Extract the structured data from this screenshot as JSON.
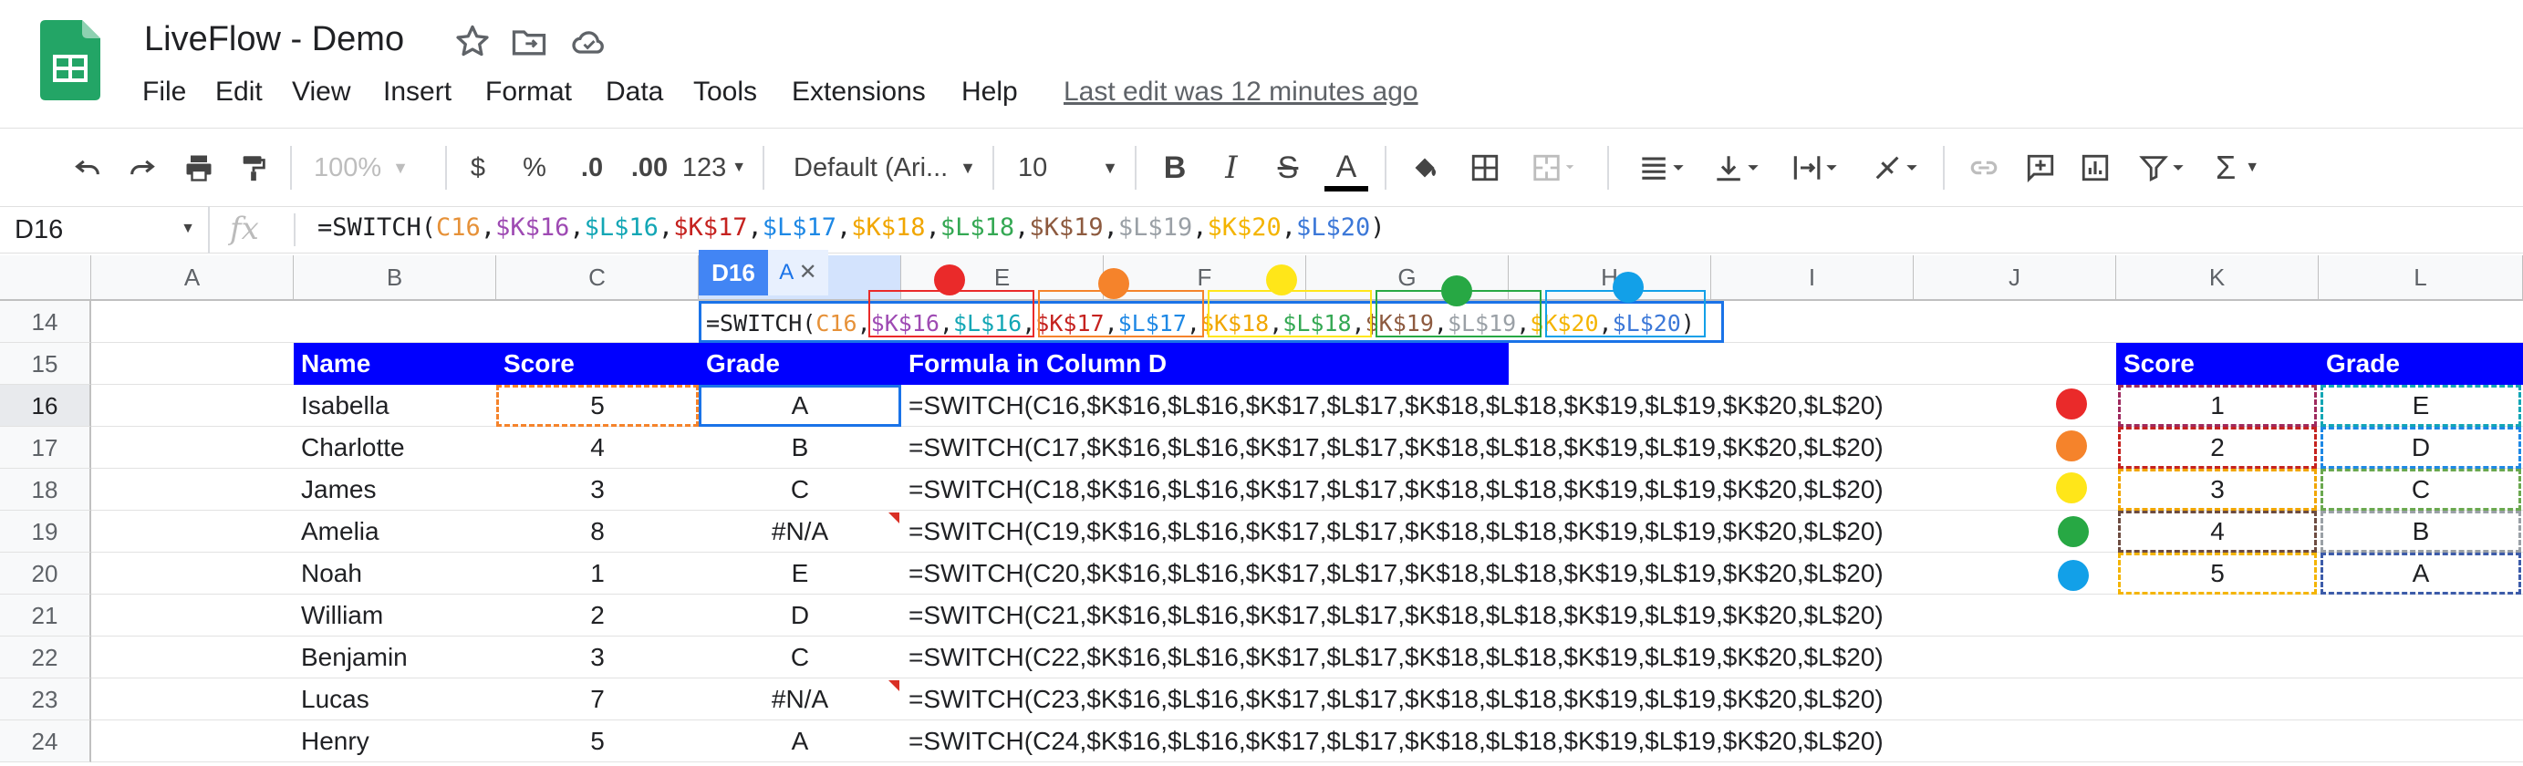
{
  "app": {
    "title": "LiveFlow - Demo"
  },
  "menu": [
    "File",
    "Edit",
    "View",
    "Insert",
    "Format",
    "Data",
    "Tools",
    "Extensions",
    "Help"
  ],
  "last_edit": "Last edit was 12 minutes ago",
  "toolbar": {
    "zoom": "100%",
    "currency": "$",
    "percent": "%",
    "dec_less": ".0",
    "dec_more": ".00",
    "num_format": "123",
    "font": "Default (Ari...",
    "font_size": "10",
    "bold": "B",
    "italic": "I",
    "strike": "S",
    "text_color": "A",
    "sigma": "Σ"
  },
  "namebox": "D16",
  "formula_bar": {
    "fx": "fx",
    "parts": [
      "=SWITCH(",
      "C16",
      ",",
      "$K$16",
      ",",
      "$L$16",
      ",",
      "$K$17",
      ",",
      "$L$17",
      ",",
      "$K$18",
      ",",
      "$L$18",
      ",",
      "$K$19",
      ",",
      "$L$19",
      ",",
      "$K$20",
      ",",
      "$L$20",
      ")"
    ]
  },
  "columns": [
    "A",
    "B",
    "C",
    "D",
    "E",
    "F",
    "G",
    "H",
    "I",
    "J",
    "K",
    "L"
  ],
  "rows": [
    "14",
    "15",
    "16",
    "17",
    "18",
    "19",
    "20",
    "21",
    "22",
    "23",
    "24"
  ],
  "cell_tooltip": {
    "ref": "D16",
    "a": "A",
    "x": "✕"
  },
  "table": {
    "headers": [
      "Name",
      "Score",
      "Grade",
      "Formula in Column D"
    ],
    "rows": [
      {
        "name": "Isabella",
        "score": "5",
        "grade": "A",
        "formula": "=SWITCH(C16,$K$16,$L$16,$K$17,$L$17,$K$18,$L$18,$K$19,$L$19,$K$20,$L$20)"
      },
      {
        "name": "Charlotte",
        "score": "4",
        "grade": "B",
        "formula": "=SWITCH(C17,$K$16,$L$16,$K$17,$L$17,$K$18,$L$18,$K$19,$L$19,$K$20,$L$20)"
      },
      {
        "name": "James",
        "score": "3",
        "grade": "C",
        "formula": "=SWITCH(C18,$K$16,$L$16,$K$17,$L$17,$K$18,$L$18,$K$19,$L$19,$K$20,$L$20)"
      },
      {
        "name": "Amelia",
        "score": "8",
        "grade": "#N/A",
        "formula": "=SWITCH(C19,$K$16,$L$16,$K$17,$L$17,$K$18,$L$18,$K$19,$L$19,$K$20,$L$20)"
      },
      {
        "name": "Noah",
        "score": "1",
        "grade": "E",
        "formula": "=SWITCH(C20,$K$16,$L$16,$K$17,$L$17,$K$18,$L$18,$K$19,$L$19,$K$20,$L$20)"
      },
      {
        "name": "William",
        "score": "2",
        "grade": "D",
        "formula": "=SWITCH(C21,$K$16,$L$16,$K$17,$L$17,$K$18,$L$18,$K$19,$L$19,$K$20,$L$20)"
      },
      {
        "name": "Benjamin",
        "score": "3",
        "grade": "C",
        "formula": "=SWITCH(C22,$K$16,$L$16,$K$17,$L$17,$K$18,$L$18,$K$19,$L$19,$K$20,$L$20)"
      },
      {
        "name": "Lucas",
        "score": "7",
        "grade": "#N/A",
        "formula": "=SWITCH(C23,$K$16,$L$16,$K$17,$L$17,$K$18,$L$18,$K$19,$L$19,$K$20,$L$20)"
      },
      {
        "name": "Henry",
        "score": "5",
        "grade": "A",
        "formula": "=SWITCH(C24,$K$16,$L$16,$K$17,$L$17,$K$18,$L$18,$K$19,$L$19,$K$20,$L$20)"
      }
    ]
  },
  "lookup": {
    "headers": [
      "Score",
      "Grade"
    ],
    "rows": [
      {
        "score": "1",
        "grade": "E"
      },
      {
        "score": "2",
        "grade": "D"
      },
      {
        "score": "3",
        "grade": "C"
      },
      {
        "score": "4",
        "grade": "B"
      },
      {
        "score": "5",
        "grade": "A"
      }
    ]
  },
  "colors": {
    "header_blue": "#0000ff",
    "red": "#ea2a2a",
    "orange": "#f5832b",
    "yellow": "#ffe619",
    "green": "#27a844",
    "blue": "#12a0e8",
    "selection": "#1a73e8"
  }
}
